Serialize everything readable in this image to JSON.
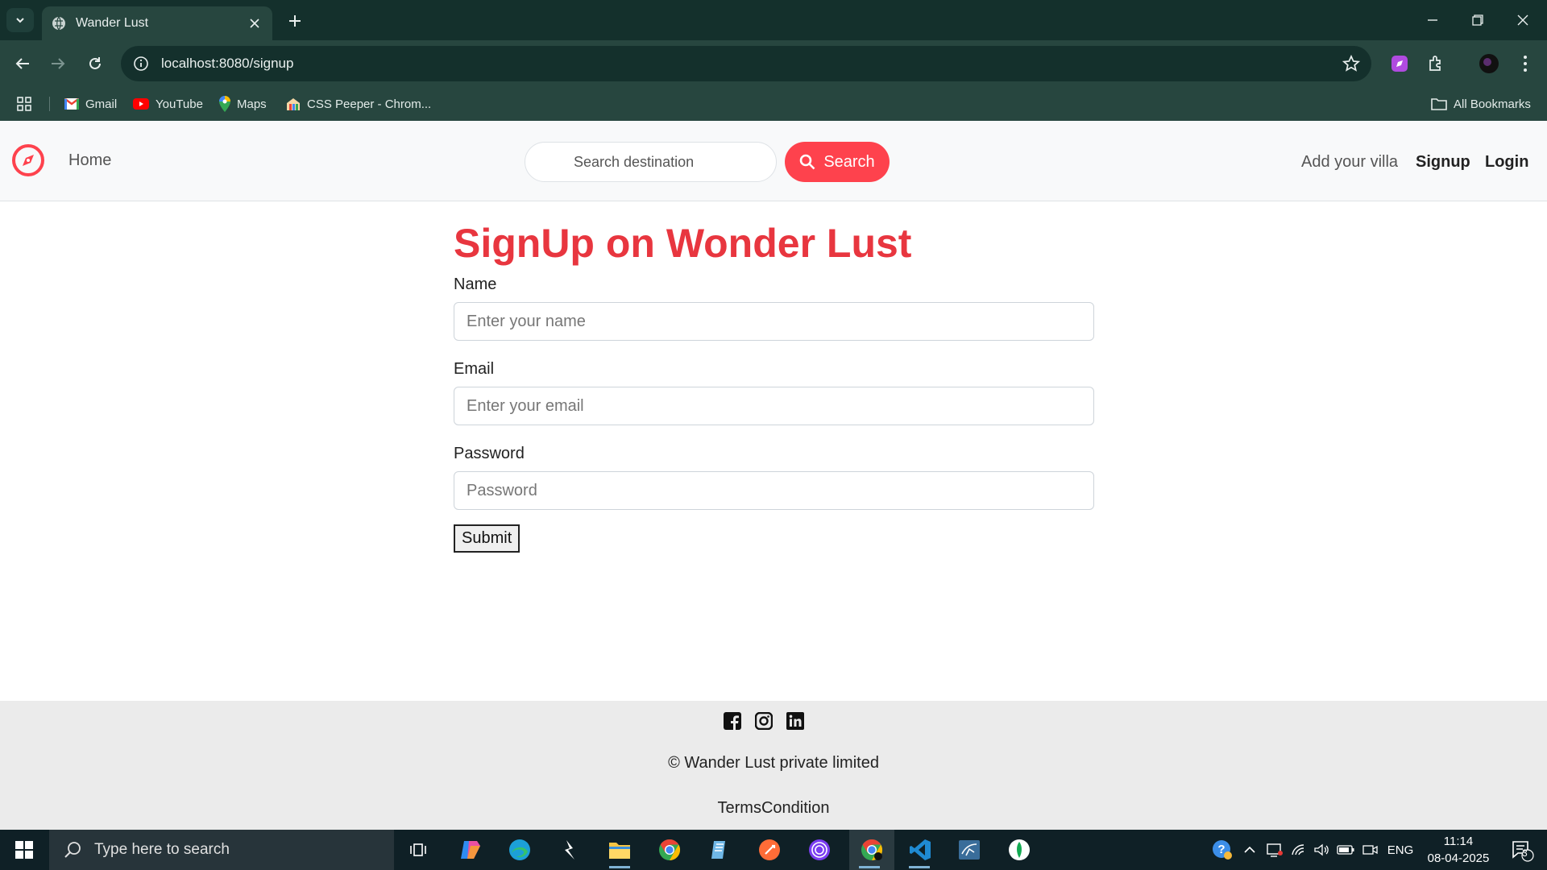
{
  "browser": {
    "tab_title": "Wander Lust",
    "url": "localhost:8080/signup",
    "bookmarks": [
      {
        "label": "Gmail",
        "icon": "gmail-icon"
      },
      {
        "label": "YouTube",
        "icon": "youtube-icon"
      },
      {
        "label": "Maps",
        "icon": "maps-icon"
      },
      {
        "label": "CSS Peeper - Chrom...",
        "icon": "css-peeper-icon"
      }
    ],
    "all_bookmarks": "All Bookmarks"
  },
  "navbar": {
    "home": "Home",
    "search_placeholder": "Search destination",
    "search_button": "Search",
    "add_villa": "Add your villa",
    "signup": "Signup",
    "login": "Login",
    "brand_color": "#fe424d"
  },
  "form": {
    "title": "SignUp on Wonder Lust",
    "name_label": "Name",
    "name_placeholder": "Enter your name",
    "email_label": "Email",
    "email_placeholder": "Enter your email",
    "password_label": "Password",
    "password_placeholder": "Password",
    "submit": "Submit"
  },
  "footer": {
    "socials": [
      "facebook-icon",
      "instagram-icon",
      "linkedin-icon"
    ],
    "copyright": "© Wander Lust private limited",
    "terms": "TermsCondition"
  },
  "taskbar": {
    "search_placeholder": "Type here to search",
    "language": "ENG",
    "time": "11:14",
    "date": "08-04-2025",
    "notification_count": "3"
  }
}
